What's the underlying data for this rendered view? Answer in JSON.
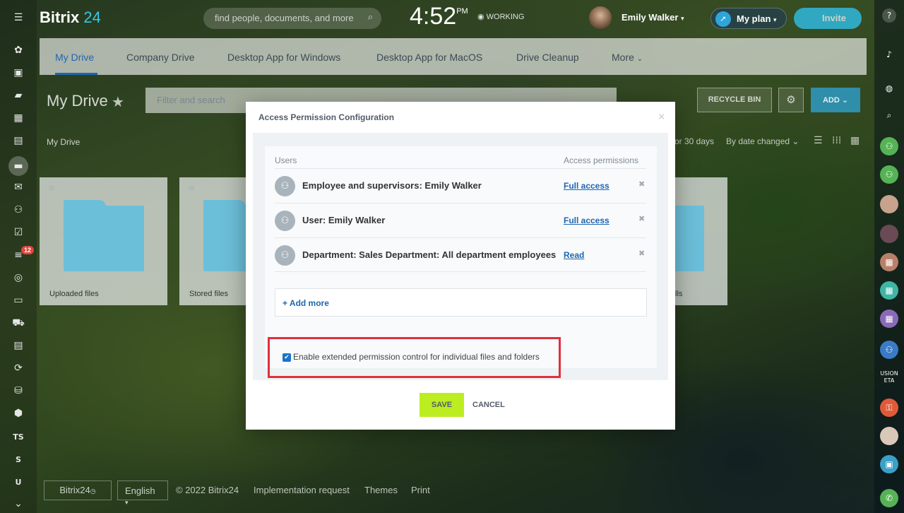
{
  "topbar": {
    "logo_text": "Bitrix",
    "logo_num": "24",
    "search_placeholder": "find people, documents, and more",
    "clock_time": "4:52",
    "clock_ampm": "PM",
    "working_status": "WORKING",
    "user_name": "Emily Walker",
    "my_plan_label": "My plan",
    "invite_label": "Invite"
  },
  "tabs": [
    {
      "label": "My Drive"
    },
    {
      "label": "Company Drive"
    },
    {
      "label": "Desktop App for Windows"
    },
    {
      "label": "Desktop App for MacOS"
    },
    {
      "label": "Drive Cleanup"
    },
    {
      "label": "More"
    }
  ],
  "page": {
    "title": "My Drive",
    "filter_placeholder": "Filter and search",
    "recycle_bin_label": "RECYCLE BIN",
    "add_label": "ADD",
    "breadcrumb": "My Drive",
    "sort_info": "or 30 days",
    "sort_order": "By date changed"
  },
  "folders": [
    {
      "name": "Uploaded files"
    },
    {
      "name": "Stored files"
    },
    {
      "name": "lls"
    }
  ],
  "left_sidebar": {
    "tasks_badge": "12",
    "labels": [
      "TS",
      "S",
      "U"
    ]
  },
  "right_sidebar": {
    "label_text": "USION ETA"
  },
  "footer": {
    "logo_text": "Bitrix24",
    "language": "English",
    "copyright": "© 2022 Bitrix24",
    "link_implementation": "Implementation request",
    "link_themes": "Themes",
    "link_print": "Print"
  },
  "modal": {
    "title": "Access Permission Configuration",
    "col_users": "Users",
    "col_permissions": "Access permissions",
    "rows": [
      {
        "who": "Employee and supervisors: Emily Walker",
        "permission": "Full access"
      },
      {
        "who": "User: Emily Walker",
        "permission": "Full access"
      },
      {
        "who": "Department: Sales Department: All department employees",
        "permission": "Read"
      }
    ],
    "add_more": "+ Add more",
    "extended_control_label": "Enable extended permission control for individual files and folders",
    "extended_control_checked": true,
    "save_label": "SAVE",
    "cancel_label": "CANCEL"
  },
  "colors": {
    "accent": "#2067b0",
    "save_button": "#bbed21",
    "highlight_border": "#e0303c"
  }
}
